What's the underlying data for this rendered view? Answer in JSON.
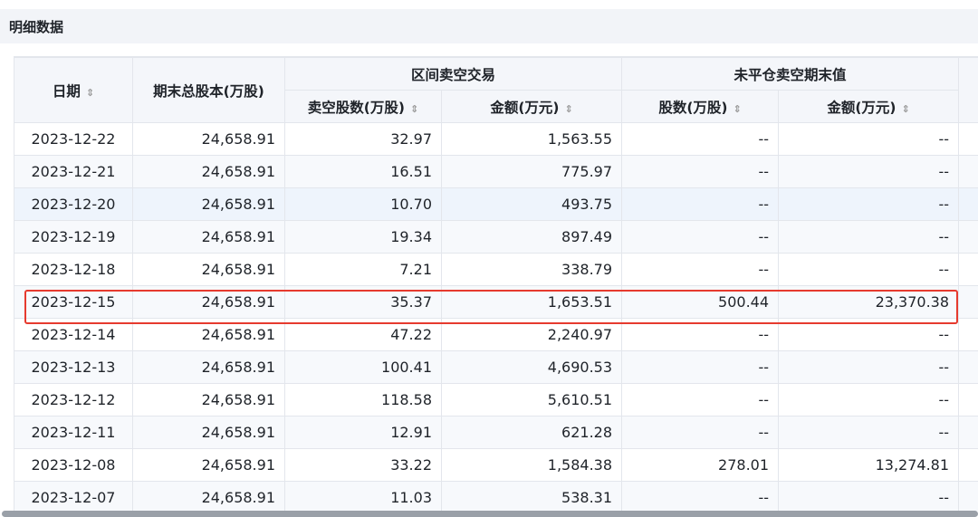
{
  "section": {
    "title": "明细数据"
  },
  "header": {
    "date": "日期",
    "total_shares": "期末总股本(万股)",
    "interval_group": "区间卖空交易",
    "short_shares": "卖空股数(万股)",
    "short_amount": "金额(万元)",
    "outstanding_group": "未平仓卖空期末值",
    "out_shares": "股数(万股)",
    "out_amount": "金额(万元)",
    "sort_icon": "⇕"
  },
  "rows": [
    {
      "date": "2023-12-22",
      "total": "24,658.91",
      "short_shares": "32.97",
      "short_amount": "1,563.55",
      "out_shares": "--",
      "out_amount": "--"
    },
    {
      "date": "2023-12-21",
      "total": "24,658.91",
      "short_shares": "16.51",
      "short_amount": "775.97",
      "out_shares": "--",
      "out_amount": "--"
    },
    {
      "date": "2023-12-20",
      "total": "24,658.91",
      "short_shares": "10.70",
      "short_amount": "493.75",
      "out_shares": "--",
      "out_amount": "--"
    },
    {
      "date": "2023-12-19",
      "total": "24,658.91",
      "short_shares": "19.34",
      "short_amount": "897.49",
      "out_shares": "--",
      "out_amount": "--"
    },
    {
      "date": "2023-12-18",
      "total": "24,658.91",
      "short_shares": "7.21",
      "short_amount": "338.79",
      "out_shares": "--",
      "out_amount": "--"
    },
    {
      "date": "2023-12-15",
      "total": "24,658.91",
      "short_shares": "35.37",
      "short_amount": "1,653.51",
      "out_shares": "500.44",
      "out_amount": "23,370.38"
    },
    {
      "date": "2023-12-14",
      "total": "24,658.91",
      "short_shares": "47.22",
      "short_amount": "2,240.97",
      "out_shares": "--",
      "out_amount": "--"
    },
    {
      "date": "2023-12-13",
      "total": "24,658.91",
      "short_shares": "100.41",
      "short_amount": "4,690.53",
      "out_shares": "--",
      "out_amount": "--"
    },
    {
      "date": "2023-12-12",
      "total": "24,658.91",
      "short_shares": "118.58",
      "short_amount": "5,610.51",
      "out_shares": "--",
      "out_amount": "--"
    },
    {
      "date": "2023-12-11",
      "total": "24,658.91",
      "short_shares": "12.91",
      "short_amount": "621.28",
      "out_shares": "--",
      "out_amount": "--"
    },
    {
      "date": "2023-12-08",
      "total": "24,658.91",
      "short_shares": "33.22",
      "short_amount": "1,584.38",
      "out_shares": "278.01",
      "out_amount": "13,274.81"
    },
    {
      "date": "2023-12-07",
      "total": "24,658.91",
      "short_shares": "11.03",
      "short_amount": "538.31",
      "out_shares": "--",
      "out_amount": "--"
    }
  ],
  "highlight_color": "#e63a2e"
}
